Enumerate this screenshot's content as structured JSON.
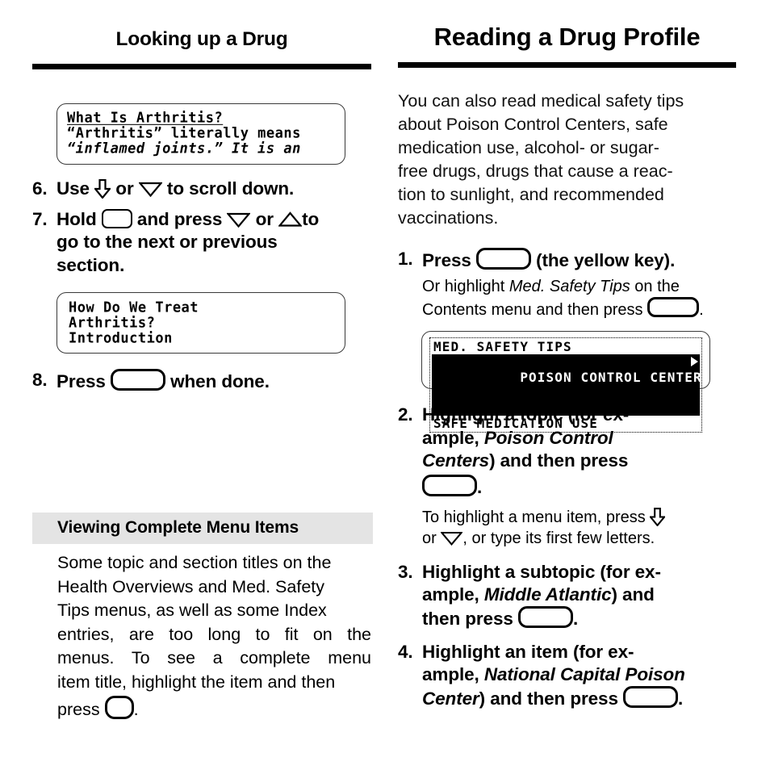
{
  "document": {
    "type": "user-manual-page",
    "columns": 2
  },
  "left_column": {
    "title": "Looking up a Drug",
    "lcd_screen_1": {
      "name": "drug-topic-screen",
      "lines": [
        {
          "text": "What Is Arthritis?",
          "style": "bold"
        },
        {
          "text": "“Arthritis” literally means",
          "style": "normal"
        },
        {
          "text": "“inflamed joints.” It is an",
          "style": "italic-partial"
        }
      ]
    },
    "steps": [
      {
        "number": "6.",
        "parts": [
          {
            "t": "text",
            "v": "Use "
          },
          {
            "t": "icon",
            "v": "down-arrow-key-icon"
          },
          {
            "t": "text",
            "v": " or "
          },
          {
            "t": "icon",
            "v": "down-triangle-key-icon"
          },
          {
            "t": "text",
            "v": " to scroll down."
          }
        ],
        "plain": "Use ⇩ or ▽ to scroll down."
      },
      {
        "number": "7.",
        "parts": [
          {
            "t": "text",
            "v": "Hold "
          },
          {
            "t": "icon",
            "v": "shift-key-icon"
          },
          {
            "t": "text",
            "v": " and press "
          },
          {
            "t": "icon",
            "v": "down-triangle-key-icon"
          },
          {
            "t": "text",
            "v": " or "
          },
          {
            "t": "icon",
            "v": "up-triangle-key-icon"
          },
          {
            "t": "text",
            "v": "to go to the next or previous section."
          }
        ],
        "plain": "Hold ⬜ and press ▽ or △ to go to the next or previous section."
      },
      {
        "number": "8.",
        "parts": [
          {
            "t": "text",
            "v": "Press "
          },
          {
            "t": "icon",
            "v": "enter-key-icon"
          },
          {
            "t": "text",
            "v": " when done."
          }
        ],
        "plain": "Press ⬭ when done."
      }
    ],
    "step7_line1_a": "Hold",
    "step7_line1_b": "and press",
    "step7_line1_c": "or",
    "step7_line1_d": "to",
    "step7_line2": "go to the next or previous",
    "step7_line3": "section.",
    "step6_a": "Use",
    "step6_b": "or",
    "step6_c": "to scroll down.",
    "step8_a": "Press",
    "step8_b": "when done.",
    "lcd_screen_2": {
      "name": "section-list-screen",
      "lines": [
        {
          "text": "How Do We Treat",
          "style": "bold"
        },
        {
          "text": "Arthritis?",
          "style": "bold"
        },
        {
          "text": "Introduction",
          "style": "bold"
        }
      ]
    },
    "section": {
      "heading": "Viewing Complete Menu Items",
      "paragraph_lines": [
        "Some topic and section titles on the",
        "Health Overviews and Med. Safety",
        "Tips menus, as well as some Index",
        "entries, are too long to fit on the",
        "menus. To see a complete menu",
        "item title, highlight the item and then"
      ],
      "last_line_a": "press",
      "last_line_b": "."
    }
  },
  "right_column": {
    "title": "Reading a Drug Profile",
    "intro_lines": [
      "You can also read medical safety tips",
      "about Poison Control Centers, safe",
      "medication use, alcohol- or sugar-",
      "free drugs, drugs that cause a reac-",
      "tion to sunlight, and recommended",
      "vaccinations."
    ],
    "steps": [
      {
        "number": "1.",
        "main_a": "Press",
        "main_b": "(the yellow key).",
        "sub_line1_a": "Or highlight",
        "sub_line1_em": "Med. Safety Tips",
        "sub_line1_b": "on the",
        "sub_line2_a": "Contents menu and then press",
        "sub_line2_b": "."
      },
      {
        "number": "2.",
        "line1": "Highlight a topic (for ex-",
        "line2_a": "ample,",
        "line2_em": "Poison Control",
        "line3_em": "Centers",
        "line3_b": ") and then press",
        "line4_b": ".",
        "sub_line1": "To highlight a menu item, press",
        "sub_line2_a": "or",
        "sub_line2_b": ", or type its first few letters."
      },
      {
        "number": "3.",
        "line1": "Highlight a subtopic (for ex-",
        "line2_a": "ample,",
        "line2_em": "Middle Atlantic",
        "line2_b": ") and",
        "line3_a": "then press",
        "line3_b": "."
      },
      {
        "number": "4.",
        "line1": "Highlight an item (for ex-",
        "line2_a": "ample,",
        "line2_em": "National Capital Poison",
        "line3_em": "Center",
        "line3_a": ") and then press",
        "line3_b": "."
      }
    ],
    "lcd_screen_3": {
      "name": "med-safety-tips-menu-screen",
      "rows": [
        {
          "text": "MED. SAFETY TIPS",
          "selected": false
        },
        {
          "text": "POISON CONTROL CENTERS",
          "selected": true
        },
        {
          "text": "SAFE MEDICATION USE",
          "selected": false
        }
      ]
    }
  },
  "icons": {
    "down_arrow_key": "down-arrow-key-icon",
    "down_triangle_key": "down-triangle-key-icon",
    "up_triangle_key": "up-triangle-key-icon",
    "shift_key": "shift-key-icon",
    "enter_key": "enter-key-icon",
    "small_oval_key": "small-oval-key-icon",
    "menu_selection_arrow": "menu-selection-arrow-icon"
  },
  "colors": {
    "text": "#000000",
    "rule": "#000000",
    "band_background": "#e4e4e4",
    "lcd_border": "#3a3a3a",
    "page_background": "#ffffff"
  }
}
